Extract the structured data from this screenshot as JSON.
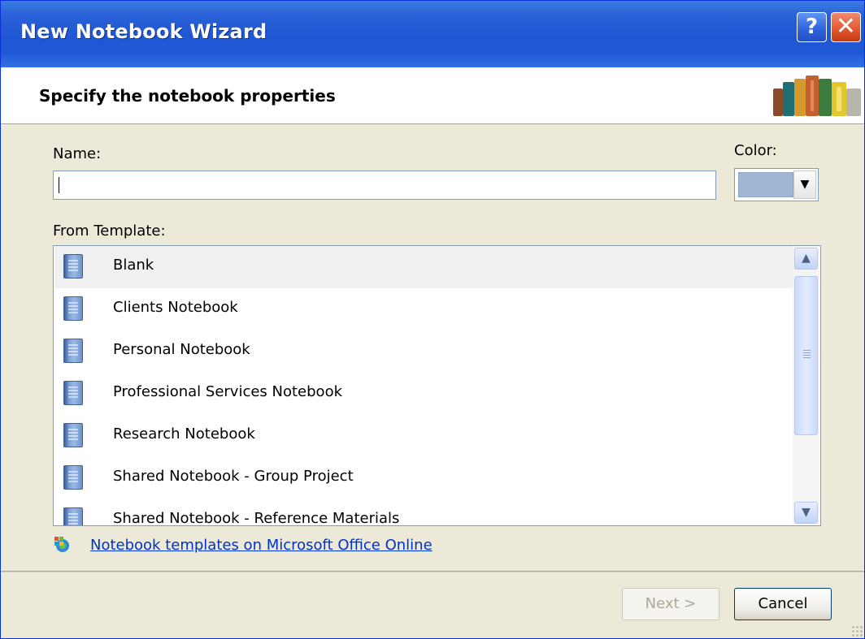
{
  "window": {
    "title": "New Notebook Wizard",
    "help_label": "?",
    "close_label": "✕"
  },
  "header": {
    "title": "Specify the notebook properties"
  },
  "form": {
    "name_label": "Name:",
    "name_value": "",
    "color_label": "Color:",
    "color_value": "#9fb7d3",
    "template_label": "From Template:"
  },
  "templates": [
    "Blank",
    "Clients Notebook",
    "Personal Notebook",
    "Professional Services Notebook",
    "Research Notebook",
    "Shared Notebook - Group Project",
    "Shared Notebook - Reference Materials"
  ],
  "selected_template": "Blank",
  "link": {
    "text": "Notebook templates on Microsoft Office Online"
  },
  "buttons": {
    "next": "Next >",
    "cancel": "Cancel"
  },
  "colors": {
    "title_blue": "#2a62d8",
    "link_blue": "#0033cc"
  }
}
